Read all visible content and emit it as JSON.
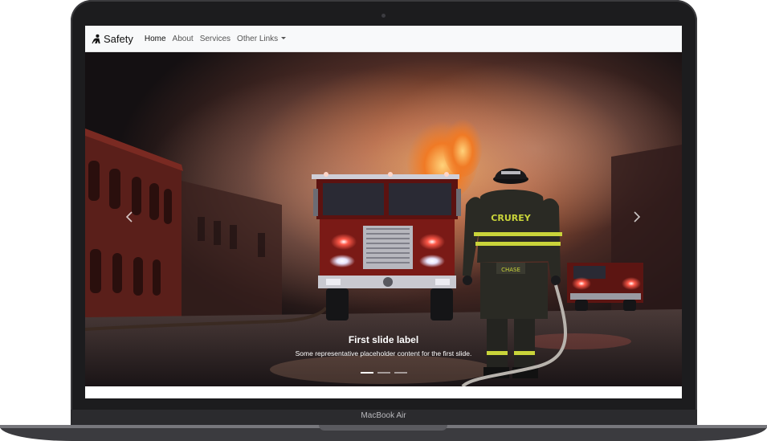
{
  "device": {
    "model_label": "MacBook Air"
  },
  "navbar": {
    "brand": "Safety",
    "links": [
      {
        "label": "Home",
        "active": true
      },
      {
        "label": "About",
        "active": false
      },
      {
        "label": "Services",
        "active": false
      },
      {
        "label": "Other Links",
        "active": false,
        "dropdown": true
      }
    ]
  },
  "carousel": {
    "slides": [
      {
        "title": "First slide label",
        "text": "Some representative placeholder content for the first slide.",
        "image": "firefighter-fire-truck-scene",
        "active": true
      }
    ],
    "indicator_count": 3,
    "active_index": 0,
    "prev_icon": "chevron-left-icon",
    "next_icon": "chevron-right-icon"
  },
  "scene": {
    "helmet_text": "CRUREY",
    "jacket_text": "CHASE"
  },
  "colors": {
    "navbar_bg": "#f8f9fa",
    "reflective_stripe": "#c9d43a",
    "truck_red": "#7a1a16"
  }
}
